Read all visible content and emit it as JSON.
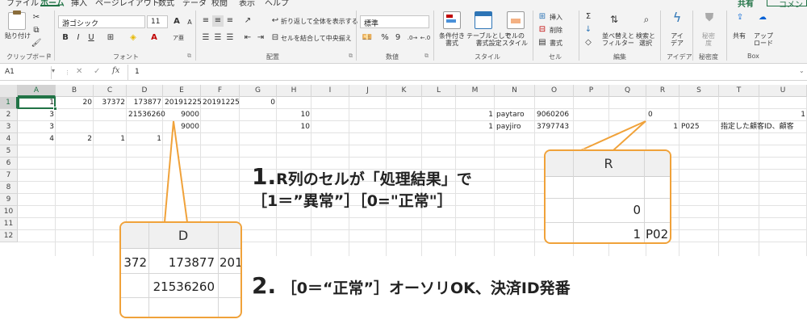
{
  "tabs": [
    "ファイル",
    "ホーム",
    "挿入",
    "ページレイアウト",
    "数式",
    "データ",
    "校閲",
    "表示",
    "ヘルプ"
  ],
  "share_label": "共有",
  "comment_label": "コメント",
  "ribbon": {
    "clipboard": {
      "paste": "貼り付け",
      "group": "クリップボード"
    },
    "font": {
      "name": "游ゴシック",
      "size": "11",
      "group": "フォント",
      "grow": "A",
      "shrink": "A",
      "bold": "B",
      "italic": "I",
      "underline": "U"
    },
    "alignment": {
      "wrap": "折り返して全体を表示する",
      "merge": "セルを結合して中央揃え",
      "group": "配置"
    },
    "number": {
      "format": "標準",
      "group": "数値",
      "percent": "%",
      "comma": "9"
    },
    "styles": {
      "conditional": "条件付き\n書式",
      "table": "テーブルとして\n書式設定",
      "cell": "セルの\nスタイル",
      "group": "スタイル"
    },
    "cells": {
      "insert": "挿入",
      "delete": "削除",
      "format": "書式",
      "group": "セル"
    },
    "editing": {
      "sort": "並べ替えと\nフィルター",
      "find": "検索と\n選択",
      "group": "編集"
    },
    "ideas": {
      "label": "アイ\nデア",
      "group": "アイデア"
    },
    "sensitivity": {
      "label": "秘密\n度",
      "group": "秘密度"
    },
    "box": {
      "share": "共有",
      "upload": "アップ\nロード",
      "group": "Box"
    }
  },
  "formula_bar": {
    "name_box": "A1",
    "cancel": "✕",
    "enter": "✓",
    "fx": "fx",
    "value": "1"
  },
  "columns": [
    "A",
    "B",
    "C",
    "D",
    "E",
    "F",
    "G",
    "H",
    "I",
    "J",
    "K",
    "L",
    "M",
    "N",
    "O",
    "P",
    "Q",
    "R",
    "S",
    "T",
    "U"
  ],
  "rows": [
    "1",
    "2",
    "3",
    "4",
    "5",
    "6",
    "7",
    "8",
    "9",
    "10",
    "11",
    "12"
  ],
  "cells": [
    {
      "col": "A",
      "row": 1,
      "v": "1",
      "num": true
    },
    {
      "col": "B",
      "row": 1,
      "v": "20",
      "num": true
    },
    {
      "col": "C",
      "row": 1,
      "v": "37372",
      "num": true
    },
    {
      "col": "D",
      "row": 1,
      "v": "173877",
      "num": true
    },
    {
      "col": "E",
      "row": 1,
      "v": "20191225",
      "num": true
    },
    {
      "col": "F",
      "row": 1,
      "v": "20191225",
      "num": true
    },
    {
      "col": "G",
      "row": 1,
      "v": "0",
      "num": true
    },
    {
      "col": "A",
      "row": 2,
      "v": "3",
      "num": true
    },
    {
      "col": "D",
      "row": 2,
      "v": "21536260",
      "num": true
    },
    {
      "col": "E",
      "row": 2,
      "v": "9000",
      "num": true
    },
    {
      "col": "H",
      "row": 2,
      "v": "10",
      "num": true
    },
    {
      "col": "M",
      "row": 2,
      "v": "1",
      "num": true
    },
    {
      "col": "N",
      "row": 2,
      "v": "paytaro",
      "num": false
    },
    {
      "col": "O",
      "row": 2,
      "v": "9060206",
      "num": false
    },
    {
      "col": "R",
      "row": 2,
      "v": "0",
      "num": false
    },
    {
      "col": "U",
      "row": 2,
      "v": "1",
      "num": true
    },
    {
      "col": "A",
      "row": 3,
      "v": "3",
      "num": true
    },
    {
      "col": "E",
      "row": 3,
      "v": "9000",
      "num": true
    },
    {
      "col": "H",
      "row": 3,
      "v": "10",
      "num": true
    },
    {
      "col": "M",
      "row": 3,
      "v": "1",
      "num": true
    },
    {
      "col": "N",
      "row": 3,
      "v": "payjiro",
      "num": false
    },
    {
      "col": "O",
      "row": 3,
      "v": "3797743",
      "num": false
    },
    {
      "col": "R",
      "row": 3,
      "v": "1",
      "num": true
    },
    {
      "col": "S",
      "row": 3,
      "v": "P025",
      "num": false
    },
    {
      "col": "T",
      "row": 3,
      "v": "指定した顧客ID、顧客",
      "num": false
    },
    {
      "col": "A",
      "row": 4,
      "v": "4",
      "num": true
    },
    {
      "col": "B",
      "row": 4,
      "v": "2",
      "num": true
    },
    {
      "col": "C",
      "row": 4,
      "v": "1",
      "num": true
    },
    {
      "col": "D",
      "row": 4,
      "v": "1",
      "num": true
    }
  ],
  "callout_r": {
    "header": "R",
    "values": [
      "0",
      "1"
    ],
    "right_text": "P02"
  },
  "callout_d": {
    "header": "D",
    "left_val": "372",
    "top_val": "173877",
    "right_val": "201",
    "bottom_val": "21536260"
  },
  "annot1": {
    "num": "1.",
    "line1": "R列のセルが「処理結果」で",
    "line2": "［1＝”異常”］［0=\"正常\"］"
  },
  "annot2": {
    "num": "2.",
    "text": "［0＝“正常”］オーソリOK、決済ID発番"
  },
  "colors": {
    "accent": "#217346",
    "callout_border": "#f0a23a"
  }
}
